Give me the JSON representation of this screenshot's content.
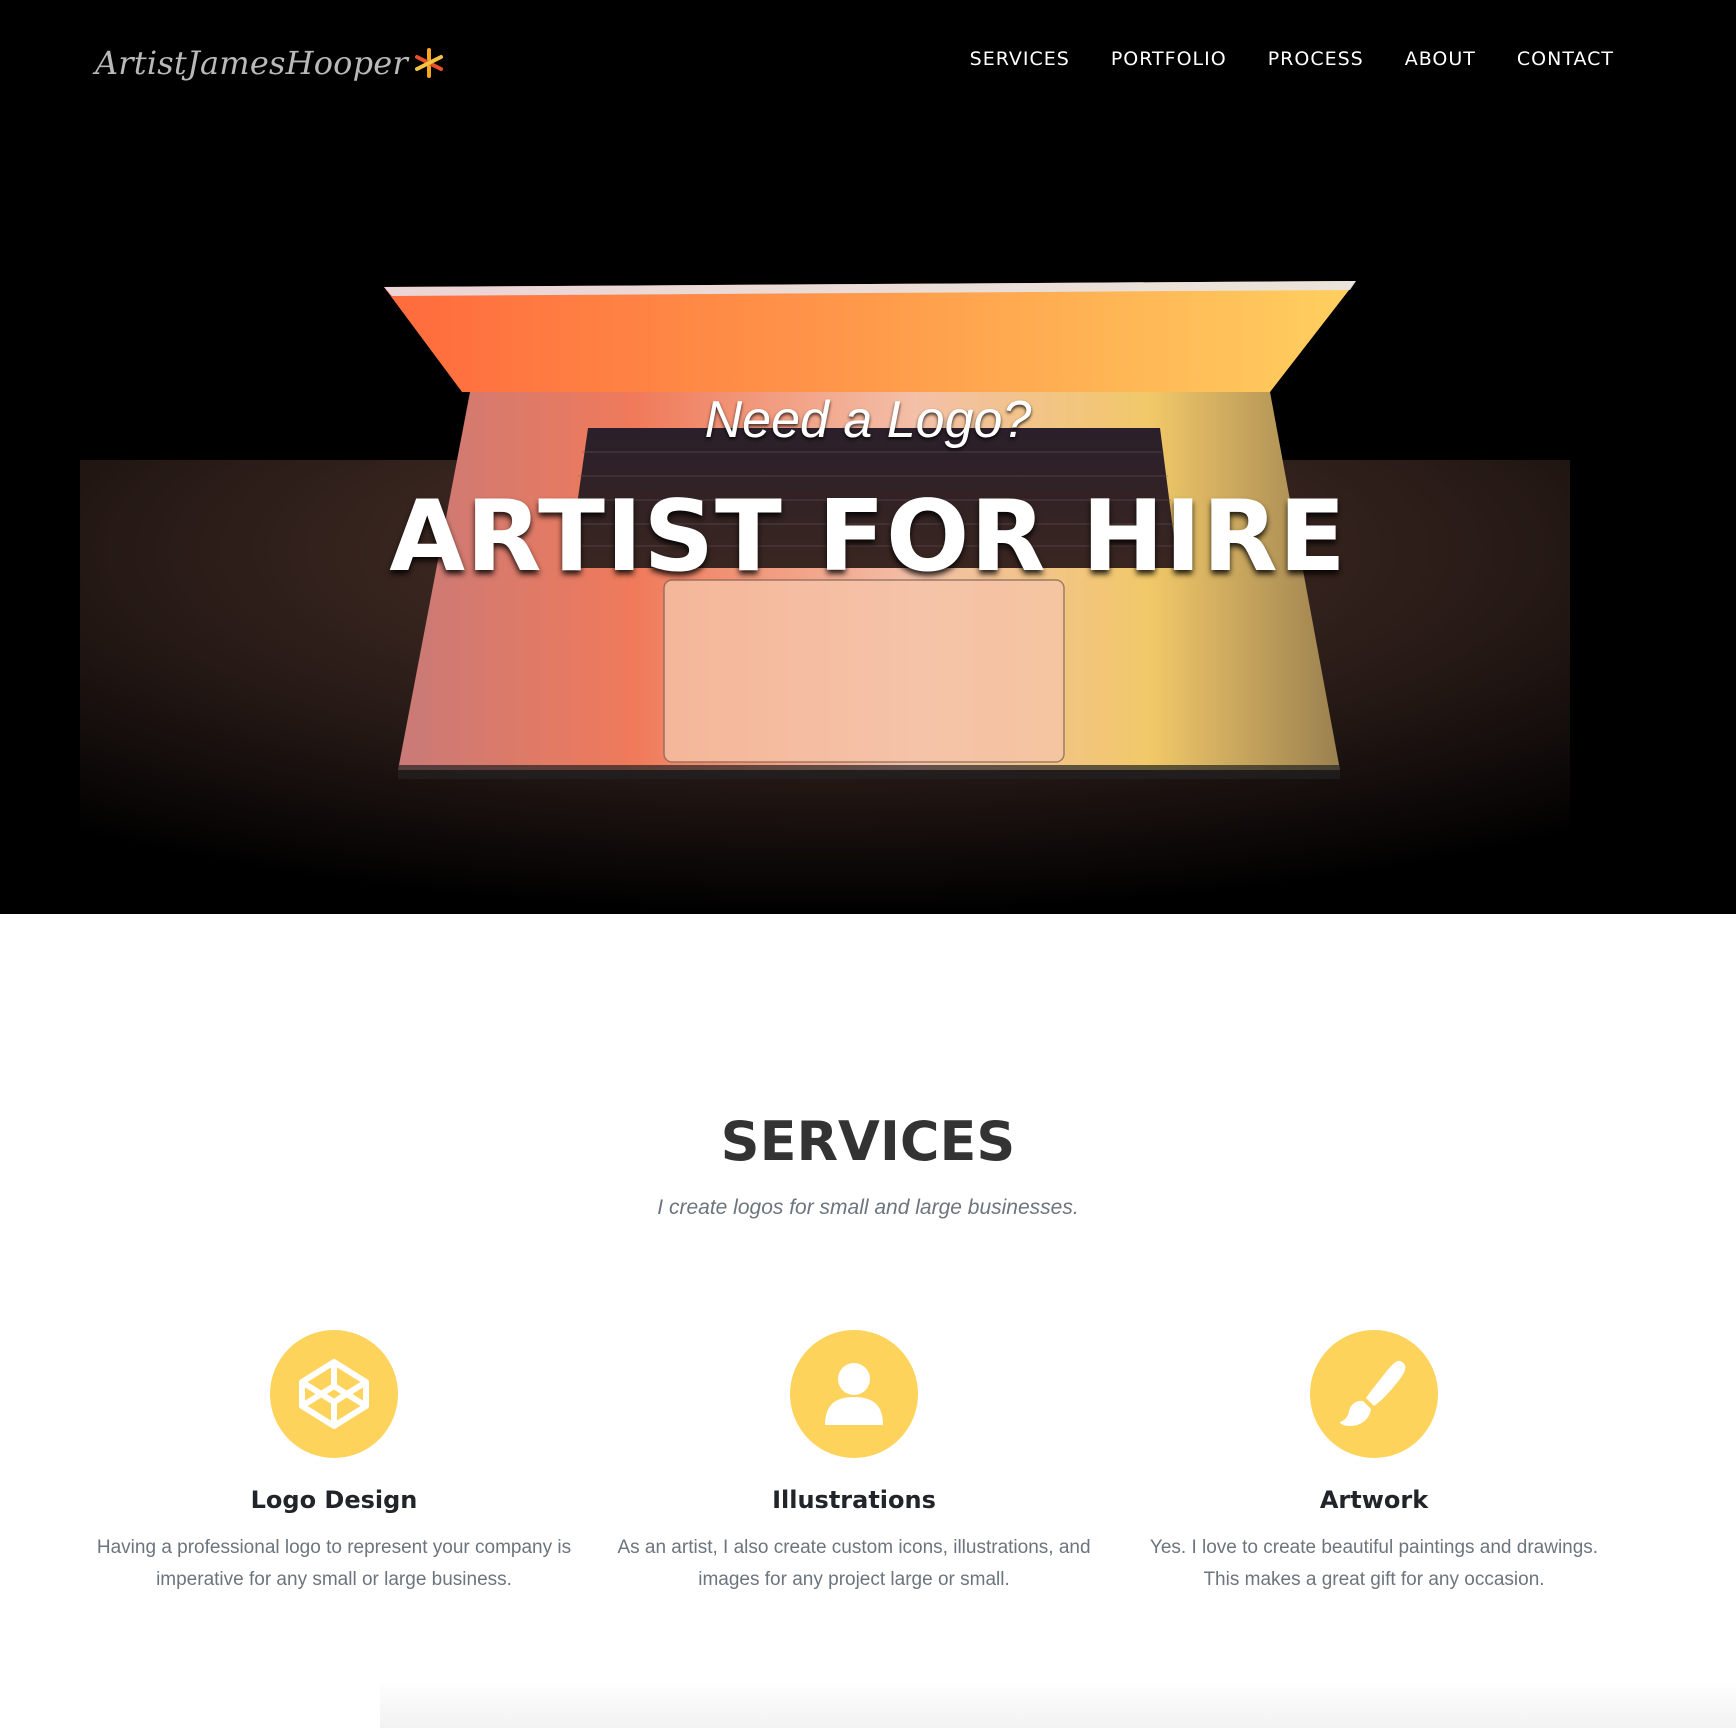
{
  "brand": {
    "name": "ArtistJamesHooper",
    "accent": "#f5a623"
  },
  "nav": {
    "items": [
      {
        "label": "SERVICES"
      },
      {
        "label": "PORTFOLIO"
      },
      {
        "label": "PROCESS"
      },
      {
        "label": "ABOUT"
      },
      {
        "label": "CONTACT"
      }
    ]
  },
  "hero": {
    "subtitle": "Need a Logo?",
    "title": "ARTIST FOR HIRE",
    "image": "laptop-glowing-keyboard-photo"
  },
  "services": {
    "heading": "SERVICES",
    "subheading": "I create logos for small and large businesses.",
    "icon_color": "#fdd35c",
    "items": [
      {
        "icon": "codepen-cube-icon",
        "title": "Logo Design",
        "text": "Having a professional logo to represent your company is imperative for any small or large business."
      },
      {
        "icon": "user-icon",
        "title": "Illustrations",
        "text": "As an artist, I also create custom icons, illustrations, and images for any project large or small."
      },
      {
        "icon": "paint-brush-icon",
        "title": "Artwork",
        "text": "Yes. I love to create beautiful paintings and drawings. This makes a great gift for any occasion."
      }
    ]
  }
}
